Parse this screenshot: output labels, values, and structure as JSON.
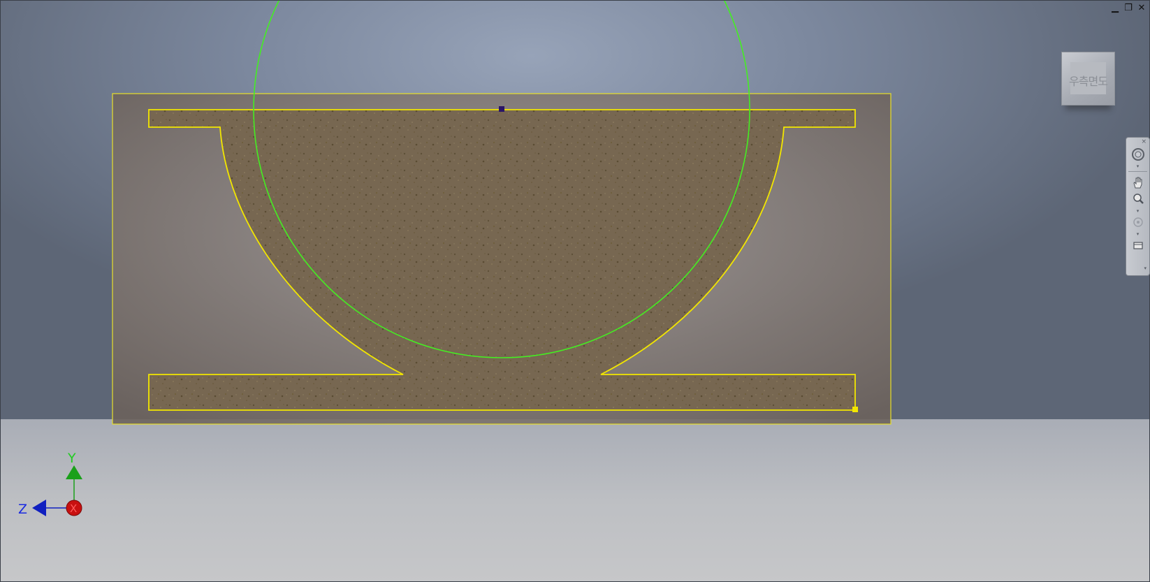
{
  "window_controls": {
    "minimize_glyph": "▁",
    "restore_glyph": "❐",
    "close_glyph": "✕"
  },
  "viewcube": {
    "label": "우측면도"
  },
  "navigation_bar": {
    "close_glyph": "×",
    "full_wheel_icon": "steering-wheel-icon",
    "pan_icon": "pan-hand-icon",
    "zoom_icon": "zoom-icon",
    "orbit_icon": "orbit-icon",
    "look_at_icon": "look-at-icon",
    "customize_glyph": "▾"
  },
  "axis_triad": {
    "y_label": "Y",
    "z_label": "Z",
    "x_label": "X"
  },
  "colors": {
    "profile_outline": "#f2e600",
    "selection_box": "#e8e02a",
    "construction_circle": "#44ee22",
    "material_fill": "#7a6a52",
    "y_axis": "#1aa01a",
    "z_axis": "#1020c0",
    "x_axis": "#c81010"
  }
}
